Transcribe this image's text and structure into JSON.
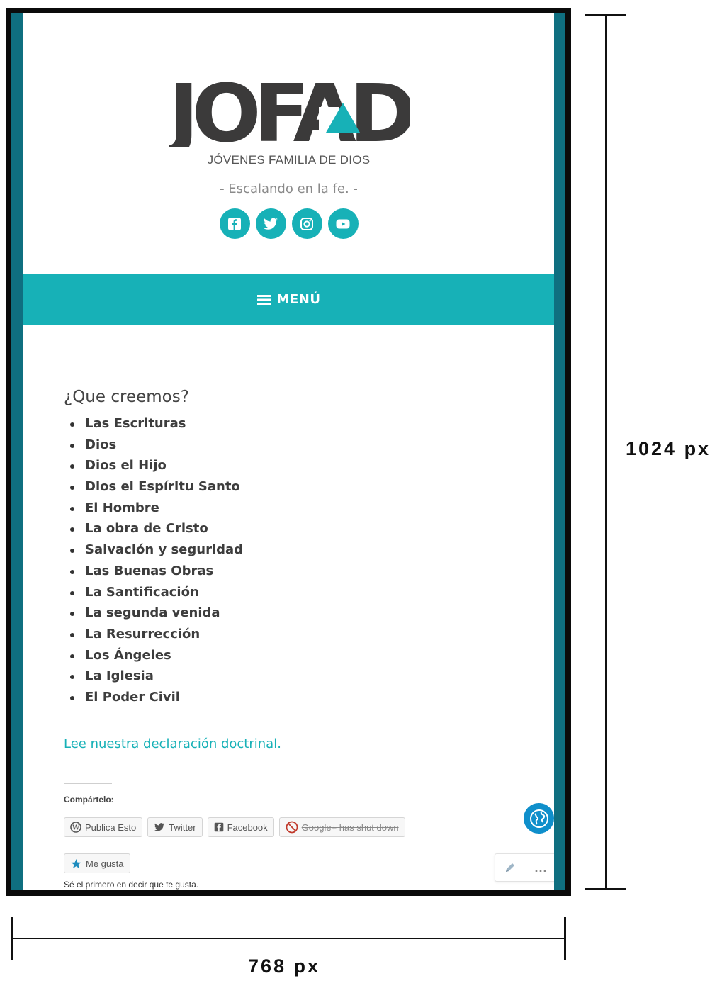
{
  "header": {
    "logo_text": "JOFAD",
    "logo_subtitle": "JÓVENES FAMILIA DE DIOS",
    "tagline": "- Escalando en la fe. -",
    "social_icons": [
      "facebook-icon",
      "twitter-icon",
      "instagram-icon",
      "youtube-icon"
    ],
    "accent_color": "#17b1b7"
  },
  "menu": {
    "label": "MENÚ"
  },
  "main": {
    "heading": "¿Que creemos?",
    "items": [
      "Las Escrituras",
      "Dios",
      "Dios el Hijo",
      "Dios el Espíritu Santo",
      "El Hombre",
      "La obra de Cristo",
      "Salvación y seguridad",
      "Las Buenas Obras",
      "La Santificación",
      "La segunda venida",
      "La Resurrección",
      "Los Ángeles",
      "La Iglesia",
      "El Poder Civil"
    ],
    "link_text": "Lee nuestra declaración doctrinal."
  },
  "share": {
    "title": "Compártelo:",
    "buttons": [
      "Publica Esto",
      "Twitter",
      "Facebook",
      "Google+ has shut down"
    ],
    "like_label": "Me gusta",
    "first_like_text": "Sé el primero en decir que te gusta."
  },
  "edit_bar": {
    "more_label": "..."
  },
  "annotations": {
    "height_label": "1024 px",
    "width_label": "768 px"
  }
}
